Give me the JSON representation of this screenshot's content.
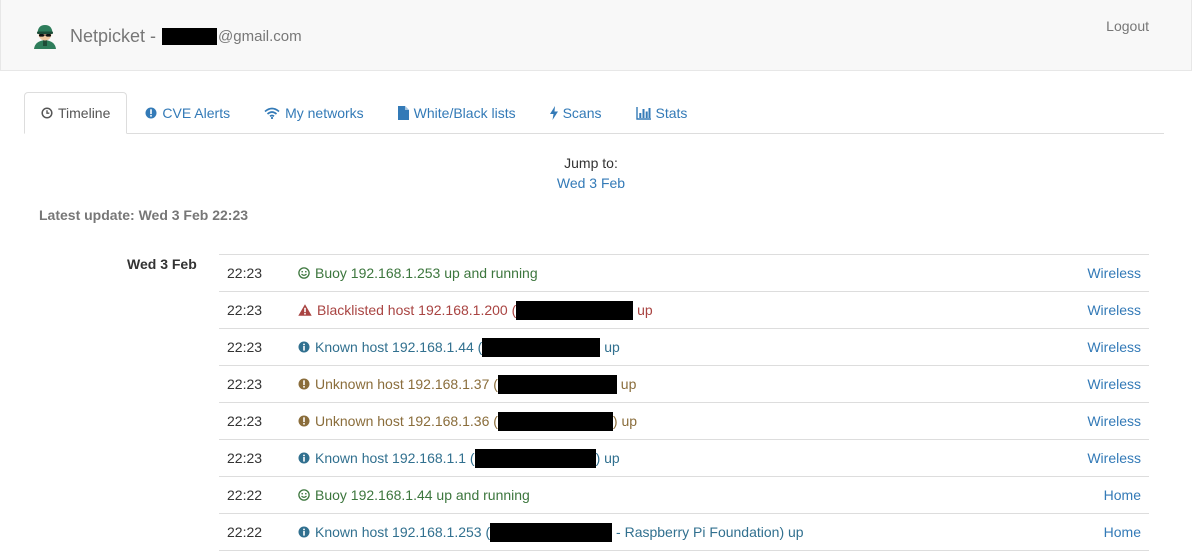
{
  "navbar": {
    "brand_name": "Netpicket -",
    "email_suffix": "@gmail.com",
    "logout_label": "Logout"
  },
  "tabs": [
    {
      "label": "Timeline",
      "icon": "clock-icon",
      "active": true
    },
    {
      "label": "CVE Alerts",
      "icon": "info-circle-icon",
      "active": false
    },
    {
      "label": "My networks",
      "icon": "wifi-icon",
      "active": false
    },
    {
      "label": "White/Black lists",
      "icon": "file-icon",
      "active": false
    },
    {
      "label": "Scans",
      "icon": "bolt-icon",
      "active": false
    },
    {
      "label": "Stats",
      "icon": "bar-chart-icon",
      "active": false
    }
  ],
  "jump": {
    "label": "Jump to:",
    "link": "Wed 3 Feb"
  },
  "latest_update": "Latest update: Wed 3 Feb 22:23",
  "timeline": {
    "day": "Wed 3 Feb",
    "events": [
      {
        "time": "22:23",
        "icon": "smile-icon",
        "tone": "success",
        "text": "Buoy 192.168.1.253 up and running",
        "after": "",
        "network": "Wireless"
      },
      {
        "time": "22:23",
        "icon": "warning-icon",
        "tone": "danger",
        "text": "Blacklisted host 192.168.1.200 (",
        "after": " up",
        "network": "Wireless"
      },
      {
        "time": "22:23",
        "icon": "info-icon",
        "tone": "info",
        "text": "Known host 192.168.1.44 (",
        "after": " up",
        "network": "Wireless"
      },
      {
        "time": "22:23",
        "icon": "exclamation-icon",
        "tone": "warning",
        "text": "Unknown host 192.168.1.37 (",
        "after": " up",
        "network": "Wireless"
      },
      {
        "time": "22:23",
        "icon": "exclamation-icon",
        "tone": "warning",
        "text": "Unknown host 192.168.1.36 (",
        "after": ") up",
        "network": "Wireless"
      },
      {
        "time": "22:23",
        "icon": "info-icon",
        "tone": "info",
        "text": "Known host 192.168.1.1 (",
        "after": ") up",
        "network": "Wireless"
      },
      {
        "time": "22:22",
        "icon": "smile-icon",
        "tone": "success",
        "text": "Buoy 192.168.1.44 up and running",
        "after": "",
        "network": "Home"
      },
      {
        "time": "22:22",
        "icon": "info-icon",
        "tone": "info",
        "text": "Known host 192.168.1.253 (",
        "after": " - Raspberry Pi Foundation) up",
        "network": "Home"
      }
    ]
  }
}
